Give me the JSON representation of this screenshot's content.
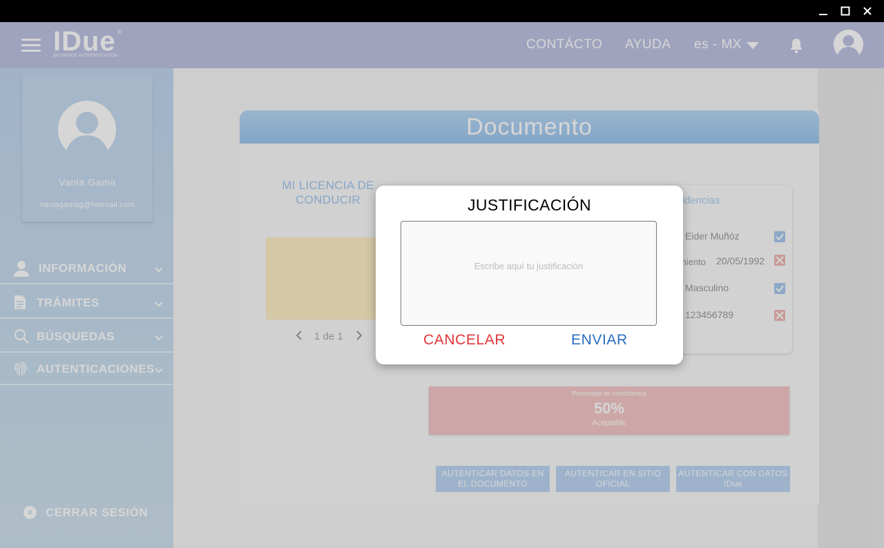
{
  "header": {
    "logo": "IDue",
    "logo_subtitle": "DILIGENCE AUTHENTICATION",
    "logo_reg": "®",
    "nav_contacto": "CONTÁCTO",
    "nav_ayuda": "AYUDA",
    "language": "es - MX"
  },
  "sidebar": {
    "user_name": "Vania Gama",
    "user_email": "vaniagamag@hotmail.com",
    "items": [
      {
        "label": "INFORMACIÓN"
      },
      {
        "label": "TRÁMITES"
      },
      {
        "label": "BÚSQUEDAS"
      },
      {
        "label": "AUTENTICACIONES"
      }
    ],
    "logout": "CERRAR SESIÓN"
  },
  "document": {
    "title": "Documento",
    "license_title": "MI LICENCIA DE CONDUCIR",
    "pager": "1 de 1",
    "matches_title": "cidencias",
    "rows": [
      {
        "label": "",
        "value": "Eider Muñóz",
        "status": "ok"
      },
      {
        "label": "miento",
        "value": "20/05/1992",
        "status": "bad"
      },
      {
        "label": "",
        "value": "Masculino",
        "status": "ok"
      },
      {
        "label": "",
        "value": "123456789",
        "status": "bad"
      }
    ],
    "percent_label": "Porcentaje de coincidencia",
    "percent_value": "50%",
    "percent_status": "Aceptable",
    "buttons": [
      "AUTENTICAR DATOS EN EL DOCUMENTO",
      "AUTENTICAR EN SITIO OFICIAL",
      "AUTENTICAR CON DATOS IDue"
    ]
  },
  "modal": {
    "title": "JUSTIFICACIÓN",
    "placeholder": "Escribe aquí tu justificación",
    "cancel": "CANCELAR",
    "send": "ENVIAR"
  },
  "colors": {
    "header_bg": "#bfc3e3",
    "sidebar_bg": "#c1d6ef",
    "cancel": "#e2343a",
    "send": "#2a6cbf",
    "match_ok": "#a8c8ee",
    "match_bad": "#f0b8b8",
    "percent_bg": "#f5c8c8"
  },
  "icons": {
    "menu": "hamburger-icon",
    "notifications": "bell-icon",
    "user": "user-avatar-icon",
    "info": "person-icon",
    "procedures": "document-icon",
    "search": "search-icon",
    "auth": "fingerprint-icon",
    "logout": "close-circle-icon"
  }
}
